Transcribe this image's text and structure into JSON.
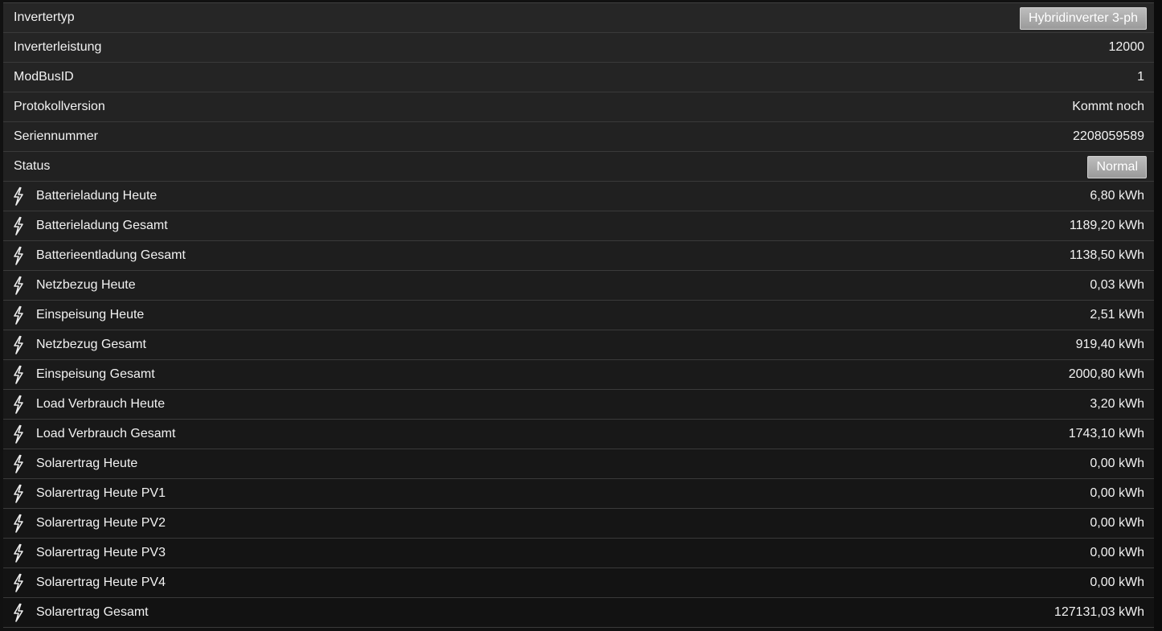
{
  "rows": [
    {
      "label": "Invertertyp",
      "value": "Hybridinverter 3-ph",
      "kind": "badge",
      "icon": null
    },
    {
      "label": "Inverterleistung",
      "value": "12000",
      "kind": "text",
      "icon": null
    },
    {
      "label": "ModBusID",
      "value": "1",
      "kind": "text",
      "icon": null
    },
    {
      "label": "Protokollversion",
      "value": "Kommt noch",
      "kind": "text",
      "icon": null
    },
    {
      "label": "Seriennummer",
      "value": "2208059589",
      "kind": "text",
      "icon": null
    },
    {
      "label": "Status",
      "value": "Normal",
      "kind": "badge",
      "icon": null
    },
    {
      "label": "Batterieladung Heute",
      "value": "6,80 kWh",
      "kind": "text",
      "icon": "lightning-icon"
    },
    {
      "label": "Batterieladung Gesamt",
      "value": "1189,20 kWh",
      "kind": "text",
      "icon": "lightning-icon"
    },
    {
      "label": "Batterieentladung Gesamt",
      "value": "1138,50 kWh",
      "kind": "text",
      "icon": "lightning-icon"
    },
    {
      "label": "Netzbezug Heute",
      "value": "0,03 kWh",
      "kind": "text",
      "icon": "lightning-icon"
    },
    {
      "label": "Einspeisung Heute",
      "value": "2,51 kWh",
      "kind": "text",
      "icon": "lightning-icon"
    },
    {
      "label": "Netzbezug Gesamt",
      "value": "919,40 kWh",
      "kind": "text",
      "icon": "lightning-icon"
    },
    {
      "label": "Einspeisung Gesamt",
      "value": "2000,80 kWh",
      "kind": "text",
      "icon": "lightning-icon"
    },
    {
      "label": "Load Verbrauch Heute",
      "value": "3,20 kWh",
      "kind": "text",
      "icon": "lightning-icon"
    },
    {
      "label": "Load Verbrauch Gesamt",
      "value": "1743,10 kWh",
      "kind": "text",
      "icon": "lightning-icon"
    },
    {
      "label": "Solarertrag Heute",
      "value": "0,00 kWh",
      "kind": "text",
      "icon": "lightning-icon"
    },
    {
      "label": "Solarertrag Heute PV1",
      "value": "0,00 kWh",
      "kind": "text",
      "icon": "lightning-icon"
    },
    {
      "label": "Solarertrag Heute PV2",
      "value": "0,00 kWh",
      "kind": "text",
      "icon": "lightning-icon"
    },
    {
      "label": "Solarertrag Heute PV3",
      "value": "0,00 kWh",
      "kind": "text",
      "icon": "lightning-icon"
    },
    {
      "label": "Solarertrag Heute PV4",
      "value": "0,00 kWh",
      "kind": "text",
      "icon": "lightning-icon"
    },
    {
      "label": "Solarertrag Gesamt",
      "value": "127131,03 kWh",
      "kind": "text",
      "icon": "lightning-icon"
    }
  ],
  "colors": {
    "background": "#111111",
    "row_text": "#f2f2f2",
    "badge_bg": "#a8a8a8"
  }
}
